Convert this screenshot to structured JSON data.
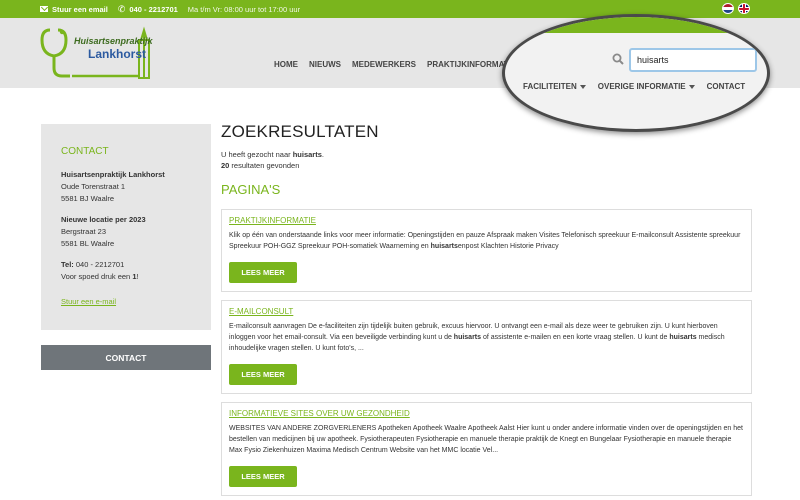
{
  "topbar": {
    "email_label": "Stuur een email",
    "phone": "040 - 2212701",
    "hours": "Ma t/m Vr: 08:00 uur tot 17:00 uur"
  },
  "logo": {
    "line1": "Huisartsenpraktijk",
    "line2": "Lankhorst"
  },
  "nav": {
    "items": [
      "HOME",
      "NIEUWS",
      "MEDEWERKERS",
      "PRAKTIJKINFORMATIE"
    ]
  },
  "lens": {
    "search_value": "huisarts",
    "menu": [
      "FACILITEITEN",
      "OVERIGE INFORMATIE",
      "CONTACT"
    ]
  },
  "sidebar": {
    "title": "CONTACT",
    "name": "Huisartsenpraktijk Lankhorst",
    "addr1": "Oude Torenstraat 1",
    "addr2": "5581 BJ  Waalre",
    "new_loc_title": "Nieuwe locatie per 2023",
    "new_addr1": "Bergstraat 23",
    "new_addr2": "5581 BL  Waalre",
    "tel_label": "Tel:",
    "tel": "040 - 2212701",
    "emergency_prefix": "Voor spoed druk een ",
    "emergency_key": "1",
    "emergency_suffix": "!",
    "mail_link": "Stuur een e-mail",
    "contact_button": "CONTACT"
  },
  "main": {
    "heading": "ZOEKRESULTATEN",
    "searched_prefix": "U heeft gezocht naar ",
    "searched_term": "huisarts",
    "searched_suffix": ".",
    "count": "20",
    "count_suffix": " resultaten gevonden",
    "section": "PAGINA'S",
    "more_label": "LEES MEER"
  },
  "results": [
    {
      "title": "PRAKTIJKINFORMATIE",
      "text_a": "Klik op één van onderstaande links voor meer informatie: Openingstijden en pauze Afspraak maken Visites Telefonisch spreekuur E-mailconsult Assistente spreekuur Spreekuur POH-GGZ Spreekuur POH-somatiek Waarneming en ",
      "hl_a": "huisarts",
      "text_b": "enpost Klachten Historie Privacy",
      "hl_b": "",
      "text_c": ""
    },
    {
      "title": "E-MAILCONSULT",
      "text_a": "E-mailconsult aanvragen  De e-faciliteiten zijn tijdelijk buiten gebruik, excuus hiervoor. U ontvangt een e-mail als deze weer te gebruiken zijn. U kunt hierboven inloggen voor het email-consult. Via een beveiligde verbinding kunt u de ",
      "hl_a": "huisarts",
      "text_b": " of assistente e-mailen en een korte vraag stellen. U kunt de ",
      "hl_b": "huisarts",
      "text_c": " medisch inhoudelijke vragen stellen. U kunt foto's, ..."
    },
    {
      "title": "INFORMATIEVE SITES OVER UW GEZONDHEID",
      "text_a": "WEBSITES VAN ANDERE ZORGVERLENERS Apotheken Apotheek Waalre Apotheek Aalst Hier kunt u onder andere informatie vinden over de openingstijden en het bestellen van medicijnen bij uw apotheek. Fysiotherapeuten Fysiotherapie en manuele therapie praktijk de Knegt en Bungelaar Fysiotherapie en manuele therapie Max Fysio Ziekenhuizen Maxima Medisch Centrum Website van het MMC locatie Vel...",
      "hl_a": "",
      "text_b": "",
      "hl_b": "",
      "text_c": ""
    }
  ],
  "colors": {
    "brand_green": "#7ab51d",
    "header_gray": "#e6e6e6",
    "button_gray": "#6f757a"
  }
}
